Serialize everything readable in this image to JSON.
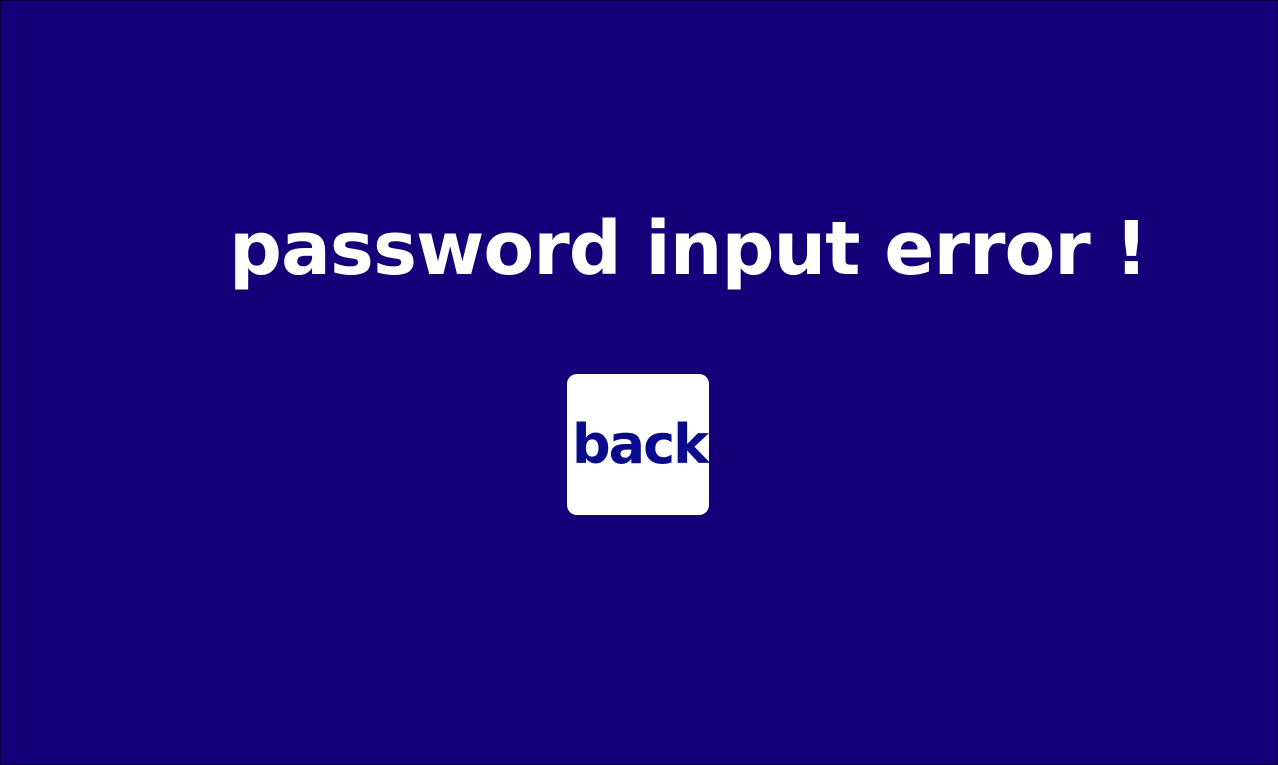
{
  "colors": {
    "background": "#16007a",
    "message_text": "#ffffff",
    "button_background": "#ffffff",
    "button_text": "#0a0a8c"
  },
  "error": {
    "message": "password input error !"
  },
  "actions": {
    "back_label": "back"
  }
}
